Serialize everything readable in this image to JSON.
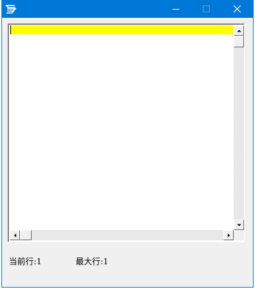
{
  "window": {
    "title": "",
    "icon": "app-logo-icon",
    "titlebar_color": "#0078d7",
    "controls": {
      "minimize_icon": "minimize-icon",
      "maximize_icon": "maximize-icon",
      "close_icon": "close-icon"
    }
  },
  "editor": {
    "highlight_color": "#ffff00",
    "current_line_text": "",
    "scrollbars": {
      "vertical": {
        "up_icon": "arrow-up-icon",
        "down_icon": "arrow-down-icon"
      },
      "horizontal": {
        "left_icon": "arrow-left-icon",
        "right_icon": "arrow-right-icon"
      }
    }
  },
  "status": {
    "current_line_label": "当前行:",
    "current_line_value": "1",
    "max_line_label": "最大行:",
    "max_line_value": "1"
  }
}
